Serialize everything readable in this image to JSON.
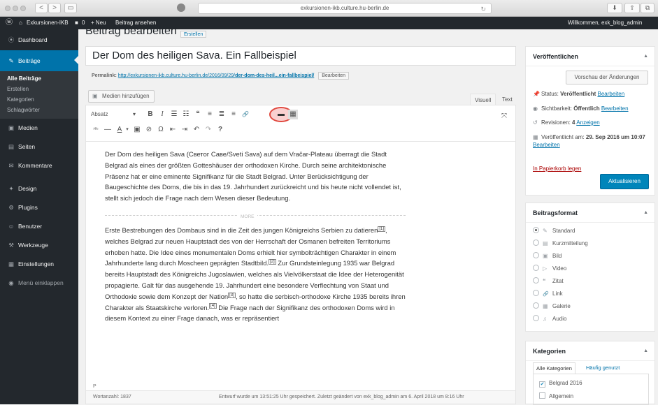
{
  "browser": {
    "url": "exkursionen-ikb.culture.hu-berlin.de",
    "back_icon": "<",
    "forward_icon": ">",
    "sidebar_icon": "▭",
    "reload_icon": "↻"
  },
  "adminbar": {
    "wp_logo": "ⓦ",
    "site_name": "Exkursionen-IKB",
    "comments_count": "0",
    "new_label": "+ Neu",
    "view_post": "Beitrag ansehen",
    "greeting": "Willkommen, exk_blog_admin"
  },
  "sidebar": {
    "items": [
      {
        "icon": "⦿",
        "label": "Dashboard"
      },
      {
        "icon": "✎",
        "label": "Beiträge"
      },
      {
        "icon": "▣",
        "label": "Medien"
      },
      {
        "icon": "▤",
        "label": "Seiten"
      },
      {
        "icon": "✉",
        "label": "Kommentare"
      },
      {
        "icon": "✦",
        "label": "Design"
      },
      {
        "icon": "⚙",
        "label": "Plugins"
      },
      {
        "icon": "☺",
        "label": "Benutzer"
      },
      {
        "icon": "⚒",
        "label": "Werkzeuge"
      },
      {
        "icon": "▦",
        "label": "Einstellungen"
      },
      {
        "icon": "◉",
        "label": "Menü einklappen"
      }
    ],
    "submenu": [
      "Alle Beiträge",
      "Erstellen",
      "Kategorien",
      "Schlagwörter"
    ]
  },
  "page": {
    "heading": "Beitrag bearbeiten",
    "add_new": "Erstellen",
    "post_title": "Der Dom des heiligen Sava. Ein Fallbeispiel",
    "permalink_label": "Permalink:",
    "permalink_base": "http://exkursionen-ikb.culture.hu-berlin.de/2016/09/29/",
    "permalink_slug": "der-dom-des-heil...ein-fallbeispiel/",
    "permalink_edit": "Bearbeiten"
  },
  "editor": {
    "media_button": "Medien hinzufügen",
    "tab_visual": "Visuell",
    "tab_text": "Text",
    "format_select": "Absatz",
    "toolbar1": [
      "B",
      "I",
      "☰",
      "☷",
      "❝",
      "≡",
      "≣",
      "≡",
      "🔗",
      "▬",
      "▦"
    ],
    "toolbar2": [
      "ᴬᴮᶜ",
      "—",
      "A",
      "▾",
      "▣",
      "⊘",
      "Ω",
      "⇤",
      "⇥",
      "↶",
      "↷",
      "?"
    ],
    "para1": "Der Dom des heiligen Sava (Светог Саве/Sveti Sava) auf dem Vračar-Plateau überragt die Stadt Belgrad als eines der größten Gotteshäuser der orthodoxen Kirche. Durch seine architektonische Präsenz hat er eine eminente Signifikanz für die Stadt Belgrad. Unter Berücksichtigung der Baugeschichte des Doms, die bis in das 19. Jahrhundert zurückreicht und bis heute nicht vollendet ist, stellt sich jedoch die Frage nach dem Wesen dieser Bedeutung.",
    "more_label": "MORE",
    "para2_a": "Erste Bestrebungen des Dombaus sind in die Zeit des jungen Königreichs Serbien zu datieren",
    "fn1": "[1]",
    "para2_b": ", welches Belgrad zur neuen Hauptstadt des von der Herrschaft der Osmanen befreiten Territoriums erhoben hatte. Die Idee eines monumentalen Doms erhielt hier symbolträchtigen Charakter in einem Jahrhunderte lang durch Moscheen geprägten Stadtbild.",
    "fn2": "[2]",
    "para2_c": " Zur Grundsteinlegung 1935 war Belgrad bereits Hauptstadt des Königreichs Jugoslawien, welches als Vielvölkerstaat die Idee der Heterogenität propagierte. Galt für das ausgehende 19. Jahrhundert eine besondere Verflechtung von Staat und Orthodoxie sowie dem Konzept der Nation",
    "fn3": "[3]",
    "para2_d": ", so hatte die serbisch-orthodoxe Kirche 1935 bereits ihren Charakter als Staatskirche verloren.",
    "fn4": "[4]",
    "para2_e": " Die Frage nach der Signifikanz des orthodoxen Doms wird in diesem Kontext zu einer Frage danach, was er repräsentiert",
    "path": "P",
    "word_count": "Wortanzahl: 1837",
    "saved_info": "Entwurf wurde um 13:51:25 Uhr gespeichert. Zuletzt geändert von exk_blog_admin am 6. April 2018 um 8:16 Uhr"
  },
  "publish": {
    "title": "Veröffentlichen",
    "preview": "Vorschau der Änderungen",
    "status_label": "Status:",
    "status_value": "Veröffentlicht",
    "visibility_label": "Sichtbarkeit:",
    "visibility_value": "Öffentlich",
    "revisions_label": "Revisionen:",
    "revisions_value": "4",
    "revisions_link": "Anzeigen",
    "published_label": "Veröffentlicht am:",
    "published_value": "29. Sep 2016 um 10:07",
    "edit_link": "Bearbeiten",
    "trash": "In Papierkorb legen",
    "update": "Aktualisieren"
  },
  "format": {
    "title": "Beitragsformat",
    "options": [
      {
        "icon": "✎",
        "label": "Standard",
        "checked": true
      },
      {
        "icon": "▤",
        "label": "Kurzmitteilung",
        "checked": false
      },
      {
        "icon": "▣",
        "label": "Bild",
        "checked": false
      },
      {
        "icon": "▷",
        "label": "Video",
        "checked": false
      },
      {
        "icon": "❝",
        "label": "Zitat",
        "checked": false
      },
      {
        "icon": "🔗",
        "label": "Link",
        "checked": false
      },
      {
        "icon": "▦",
        "label": "Galerie",
        "checked": false
      },
      {
        "icon": "♫",
        "label": "Audio",
        "checked": false
      }
    ]
  },
  "categories": {
    "title": "Kategorien",
    "tab_all": "Alle Kategorien",
    "tab_popular": "Häufig genutzt",
    "items": [
      {
        "label": "Belgrad 2016",
        "checked": true
      },
      {
        "label": "Allgemein",
        "checked": false
      }
    ]
  },
  "colors": {
    "admin_bar": "#23282d",
    "accent": "#0073aa",
    "primary_button": "#0085ba",
    "highlight_circle": "#e0483e",
    "trash_link": "#a00"
  }
}
